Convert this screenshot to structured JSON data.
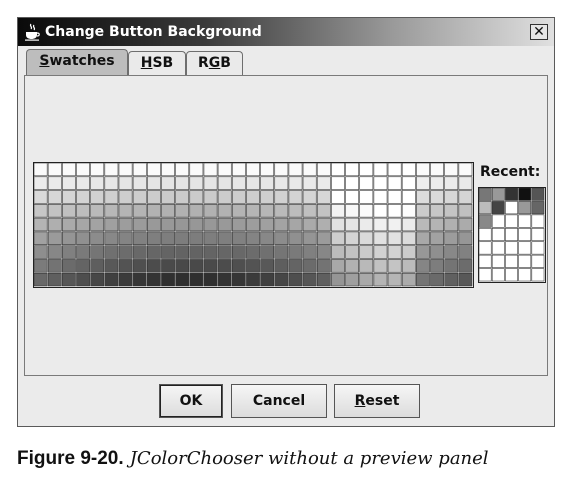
{
  "window": {
    "title": "Change Button Background",
    "close_glyph": "✕",
    "app_icon": "java-cup-icon"
  },
  "tabs": [
    {
      "label": "Swatches",
      "mnemonic": "S",
      "rest": "watches",
      "active": true
    },
    {
      "label": "HSB",
      "mnemonic": "H",
      "rest": "SB",
      "active": false
    },
    {
      "label": "RGB",
      "pre": "R",
      "mnemonic": "G",
      "rest": "B",
      "active": false
    }
  ],
  "recent": {
    "label": "Recent:"
  },
  "buttons": {
    "ok": "OK",
    "cancel": "Cancel",
    "reset_mnemonic": "R",
    "reset_rest": "eset"
  },
  "caption": {
    "number": "Figure 9-20.",
    "text": "JColorChooser without a preview panel"
  }
}
